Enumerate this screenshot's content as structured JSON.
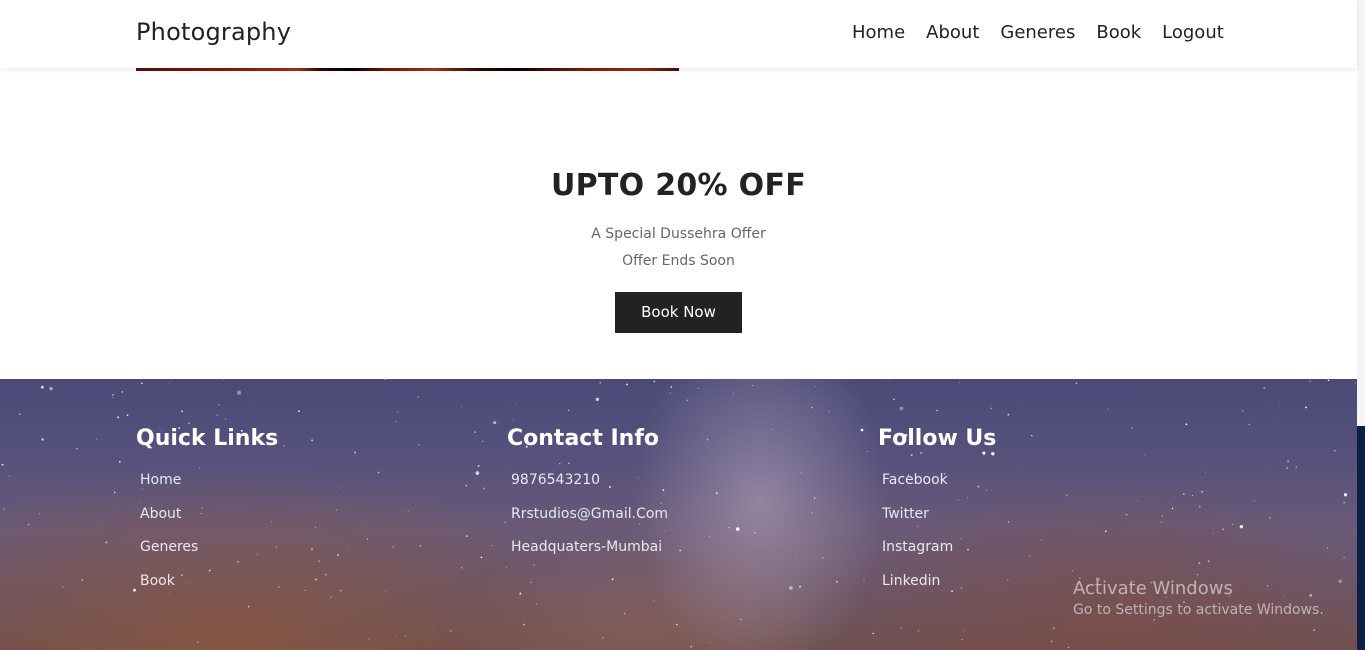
{
  "header": {
    "brand": "Photography",
    "nav": [
      "Home",
      "About",
      "Generes",
      "Book",
      "Logout"
    ]
  },
  "offer": {
    "title": "UPTO 20% OFF",
    "line1": "A Special Dussehra Offer",
    "line2": "Offer Ends Soon",
    "button_label": "Book Now"
  },
  "footer": {
    "quick_links": {
      "title": "Quick Links",
      "items": [
        "Home",
        "About",
        "Generes",
        "Book"
      ]
    },
    "contact": {
      "title": "Contact Info",
      "items": [
        "9876543210",
        "Rrstudios@Gmail.Com",
        "Headquaters-Mumbai"
      ]
    },
    "follow": {
      "title": "Follow Us",
      "items": [
        "Facebook",
        "Twitter",
        "Instagram",
        "Linkedin"
      ]
    }
  },
  "watermark": {
    "title": "Activate Windows",
    "subtitle": "Go to Settings to activate Windows."
  },
  "colors": {
    "dark_text": "#222222",
    "button_bg": "#222222",
    "footer_text": "#ffffff"
  }
}
